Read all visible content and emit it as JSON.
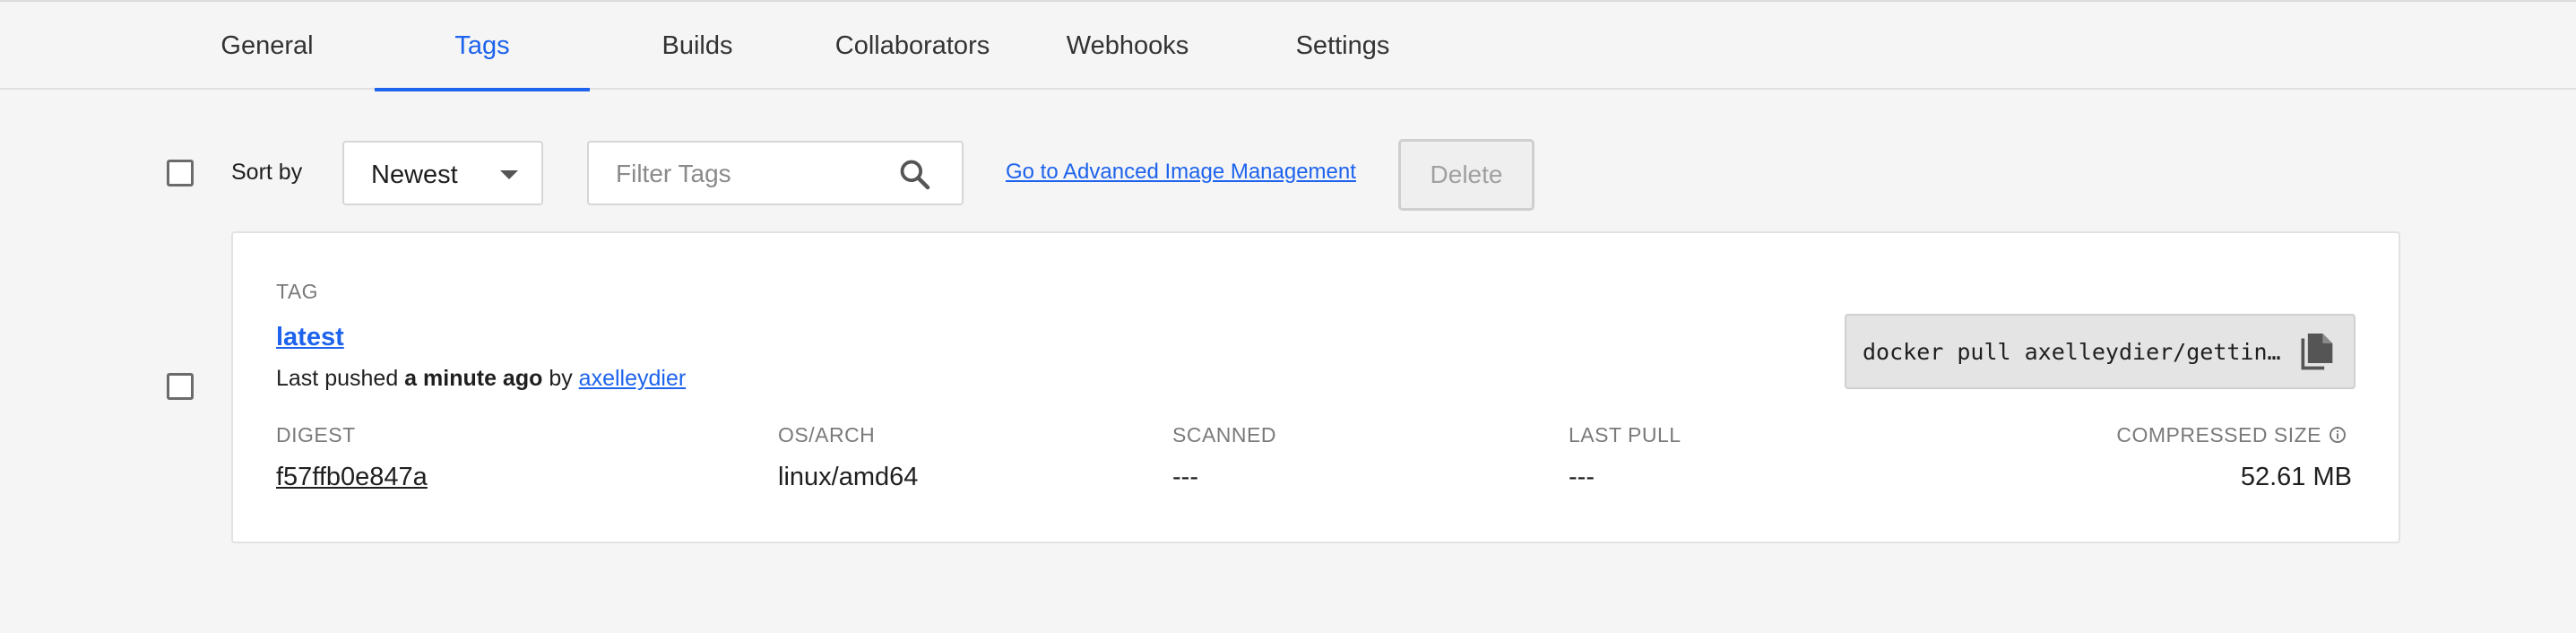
{
  "tabs": [
    {
      "label": "General"
    },
    {
      "label": "Tags"
    },
    {
      "label": "Builds"
    },
    {
      "label": "Collaborators"
    },
    {
      "label": "Webhooks"
    },
    {
      "label": "Settings"
    }
  ],
  "active_tab": "Tags",
  "toolbar": {
    "sort_label": "Sort by",
    "sort_value": "Newest",
    "filter_placeholder": "Filter Tags",
    "advanced_link": "Go to Advanced Image Management",
    "delete_label": "Delete"
  },
  "tag": {
    "header": "TAG",
    "name": "latest",
    "pushed_prefix": "Last pushed",
    "pushed_when": "a minute ago",
    "pushed_by_prefix": "by",
    "pushed_by": "axelleydier",
    "pull_command": "docker pull axelleydier/getting-started",
    "columns": {
      "digest_label": "DIGEST",
      "os_arch_label": "OS/ARCH",
      "scanned_label": "SCANNED",
      "last_pull_label": "LAST PULL",
      "size_label": "COMPRESSED SIZE"
    },
    "values": {
      "digest": "f57ffb0e847a",
      "os_arch": "linux/amd64",
      "scanned": "---",
      "last_pull": "---",
      "size": "52.61 MB"
    }
  },
  "icons": {
    "search": "search-icon",
    "copy": "copy-icon",
    "info": "info-icon",
    "caret": "chevron-down-icon"
  },
  "colors": {
    "accent": "#1d63ed",
    "background": "#f5f5f5"
  }
}
